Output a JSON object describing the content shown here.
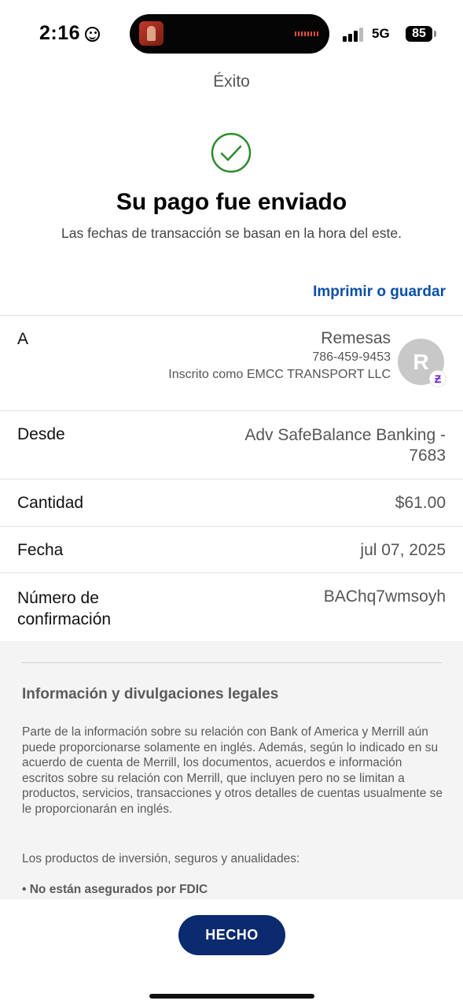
{
  "status_bar": {
    "time": "2:16",
    "network": "5G",
    "battery": "85"
  },
  "header": {
    "title": "Éxito"
  },
  "success": {
    "headline": "Su pago fue enviado",
    "subtext": "Las fechas de transacción se basan en la hora del este.",
    "print_link": "Imprimir o guardar"
  },
  "details": {
    "to_label": "A",
    "recipient_name": "Remesas",
    "recipient_phone": "786-459-9453",
    "recipient_enrolled": "Inscrito como EMCC TRANSPORT LLC",
    "avatar_initial": "R",
    "from_label": "Desde",
    "from_value": "Adv SafeBalance Banking - 7683",
    "amount_label": "Cantidad",
    "amount_value": "$61.00",
    "date_label": "Fecha",
    "date_value": "jul 07, 2025",
    "confirmation_label": "Número de confirmación",
    "confirmation_value": "BAChq7wmsoyh"
  },
  "legal": {
    "title": "Información y divulgaciones legales",
    "paragraph": "Parte de la información sobre su relación con Bank of America y Merrill aún puede proporcionarse solamente en inglés. Además, según lo indicado en su acuerdo de cuenta de Merrill, los documentos, acuerdos e información escritos sobre su relación con Merrill, que incluyen pero no se limitan a productos, servicios, transacciones y otros detalles de cuentas usualmente se le proporcionarán en inglés.",
    "products_intro": "Los productos de inversión, seguros y anualidades:",
    "bullet_1": "• No están asegurados por FDIC"
  },
  "actions": {
    "done_label": "HECHO"
  },
  "colors": {
    "accent_link": "#0a4fa8",
    "button_bg": "#0b2a6f",
    "success_green": "#2e8b2e",
    "zelle_purple": "#6d1ed4"
  },
  "icons": {
    "status_face": "smiley-icon",
    "success": "checkmark-circle-icon",
    "zelle": "zelle-icon"
  }
}
